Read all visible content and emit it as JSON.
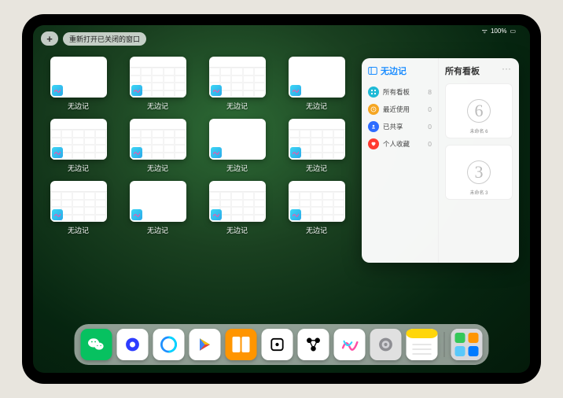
{
  "status": {
    "battery": "100%",
    "wifi": "●●●"
  },
  "toolbar": {
    "add_label": "+",
    "reopen_label": "重新打开已关闭的窗口"
  },
  "thumbs": {
    "label": "无边记",
    "items": [
      {
        "variant": "blank"
      },
      {
        "variant": "cal"
      },
      {
        "variant": "cal"
      },
      {
        "variant": "blank"
      },
      {
        "variant": "cal"
      },
      {
        "variant": "cal"
      },
      {
        "variant": "blank"
      },
      {
        "variant": "cal"
      },
      {
        "variant": "cal"
      },
      {
        "variant": "blank"
      },
      {
        "variant": "cal"
      },
      {
        "variant": "cal"
      }
    ]
  },
  "panel": {
    "title": "无边记",
    "ellipsis": "···",
    "items": [
      {
        "icon": "grid",
        "color": "#1fbad6",
        "label": "所有看板",
        "count": "8"
      },
      {
        "icon": "clock",
        "color": "#f5a623",
        "label": "最近使用",
        "count": "0"
      },
      {
        "icon": "share",
        "color": "#2d6cff",
        "label": "已共享",
        "count": "0"
      },
      {
        "icon": "heart",
        "color": "#ff3b30",
        "label": "个人收藏",
        "count": "0"
      }
    ],
    "right_title": "所有看板",
    "boards": [
      {
        "sketch": "6",
        "name": "未命名 6"
      },
      {
        "sketch": "3",
        "name": "未命名 3"
      }
    ]
  },
  "dock": {
    "apps": [
      {
        "name": "wechat",
        "bg": "#07c160",
        "glyph": "wechat"
      },
      {
        "name": "quark",
        "bg": "#fff",
        "glyph": "quark"
      },
      {
        "name": "qqbrowser",
        "bg": "#fff",
        "glyph": "qqb"
      },
      {
        "name": "appstore",
        "bg": "#fff",
        "glyph": "play"
      },
      {
        "name": "books",
        "bg": "#ff9500",
        "glyph": "books"
      },
      {
        "name": "obsidian",
        "bg": "#fff",
        "glyph": "square"
      },
      {
        "name": "connect",
        "bg": "#fff",
        "glyph": "nodes"
      },
      {
        "name": "freeform",
        "bg": "#fff",
        "glyph": "scribble"
      },
      {
        "name": "settings",
        "bg": "#e0e0e0",
        "glyph": "gear"
      },
      {
        "name": "notes",
        "bg": "#fff",
        "glyph": "notes"
      },
      {
        "name": "recent",
        "bg": "#e0e0e0",
        "glyph": "multi"
      }
    ]
  }
}
